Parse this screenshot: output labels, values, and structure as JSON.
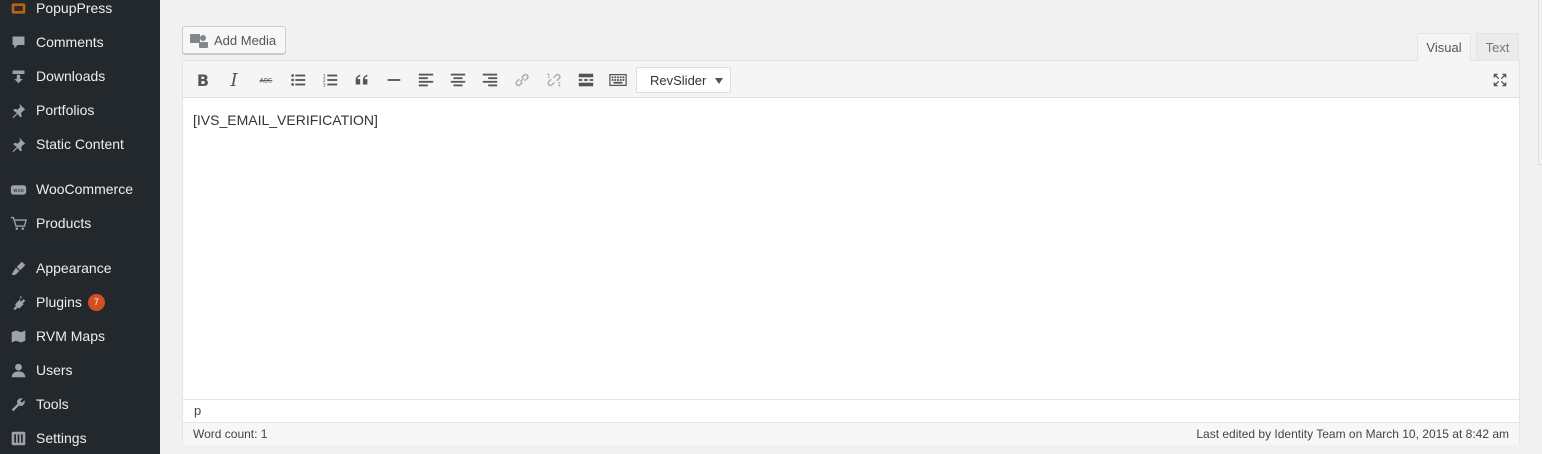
{
  "sidebar": {
    "items": [
      {
        "label": "PopupPress",
        "icon": "popuppress-icon"
      },
      {
        "label": "Comments",
        "icon": "comment-icon"
      },
      {
        "label": "Downloads",
        "icon": "download-icon"
      },
      {
        "label": "Portfolios",
        "icon": "pin-icon"
      },
      {
        "label": "Static Content",
        "icon": "pin-icon"
      },
      {
        "label": "WooCommerce",
        "icon": "woocommerce-icon"
      },
      {
        "label": "Products",
        "icon": "cart-icon"
      },
      {
        "label": "Appearance",
        "icon": "paintbrush-icon"
      },
      {
        "label": "Plugins",
        "icon": "plugin-icon",
        "badge": "7"
      },
      {
        "label": "RVM Maps",
        "icon": "map-icon"
      },
      {
        "label": "Users",
        "icon": "user-icon"
      },
      {
        "label": "Tools",
        "icon": "wrench-icon"
      },
      {
        "label": "Settings",
        "icon": "settings-icon"
      }
    ]
  },
  "editor": {
    "add_media_label": "Add Media",
    "tabs": {
      "visual": "Visual",
      "text": "Text"
    },
    "toolbar": {
      "buttons": [
        "bold",
        "italic",
        "strikethrough",
        "bulleted-list",
        "numbered-list",
        "blockquote",
        "horizontal-line",
        "align-left",
        "align-center",
        "align-right",
        "insert-link",
        "remove-link",
        "read-more",
        "toolbar-toggle"
      ],
      "revslider_label": "RevSlider",
      "fullscreen": "fullscreen"
    },
    "content": "[IVS_EMAIL_VERIFICATION]",
    "path": "p",
    "word_count": "Word count: 1",
    "last_edited": "Last edited by Identity Team on March 10, 2015 at 8:42 am"
  },
  "colors": {
    "sidebar_bg": "#23282d",
    "sidebar_text": "#eeeeee",
    "badge": "#d54e21",
    "page_bg": "#f1f1f1"
  }
}
